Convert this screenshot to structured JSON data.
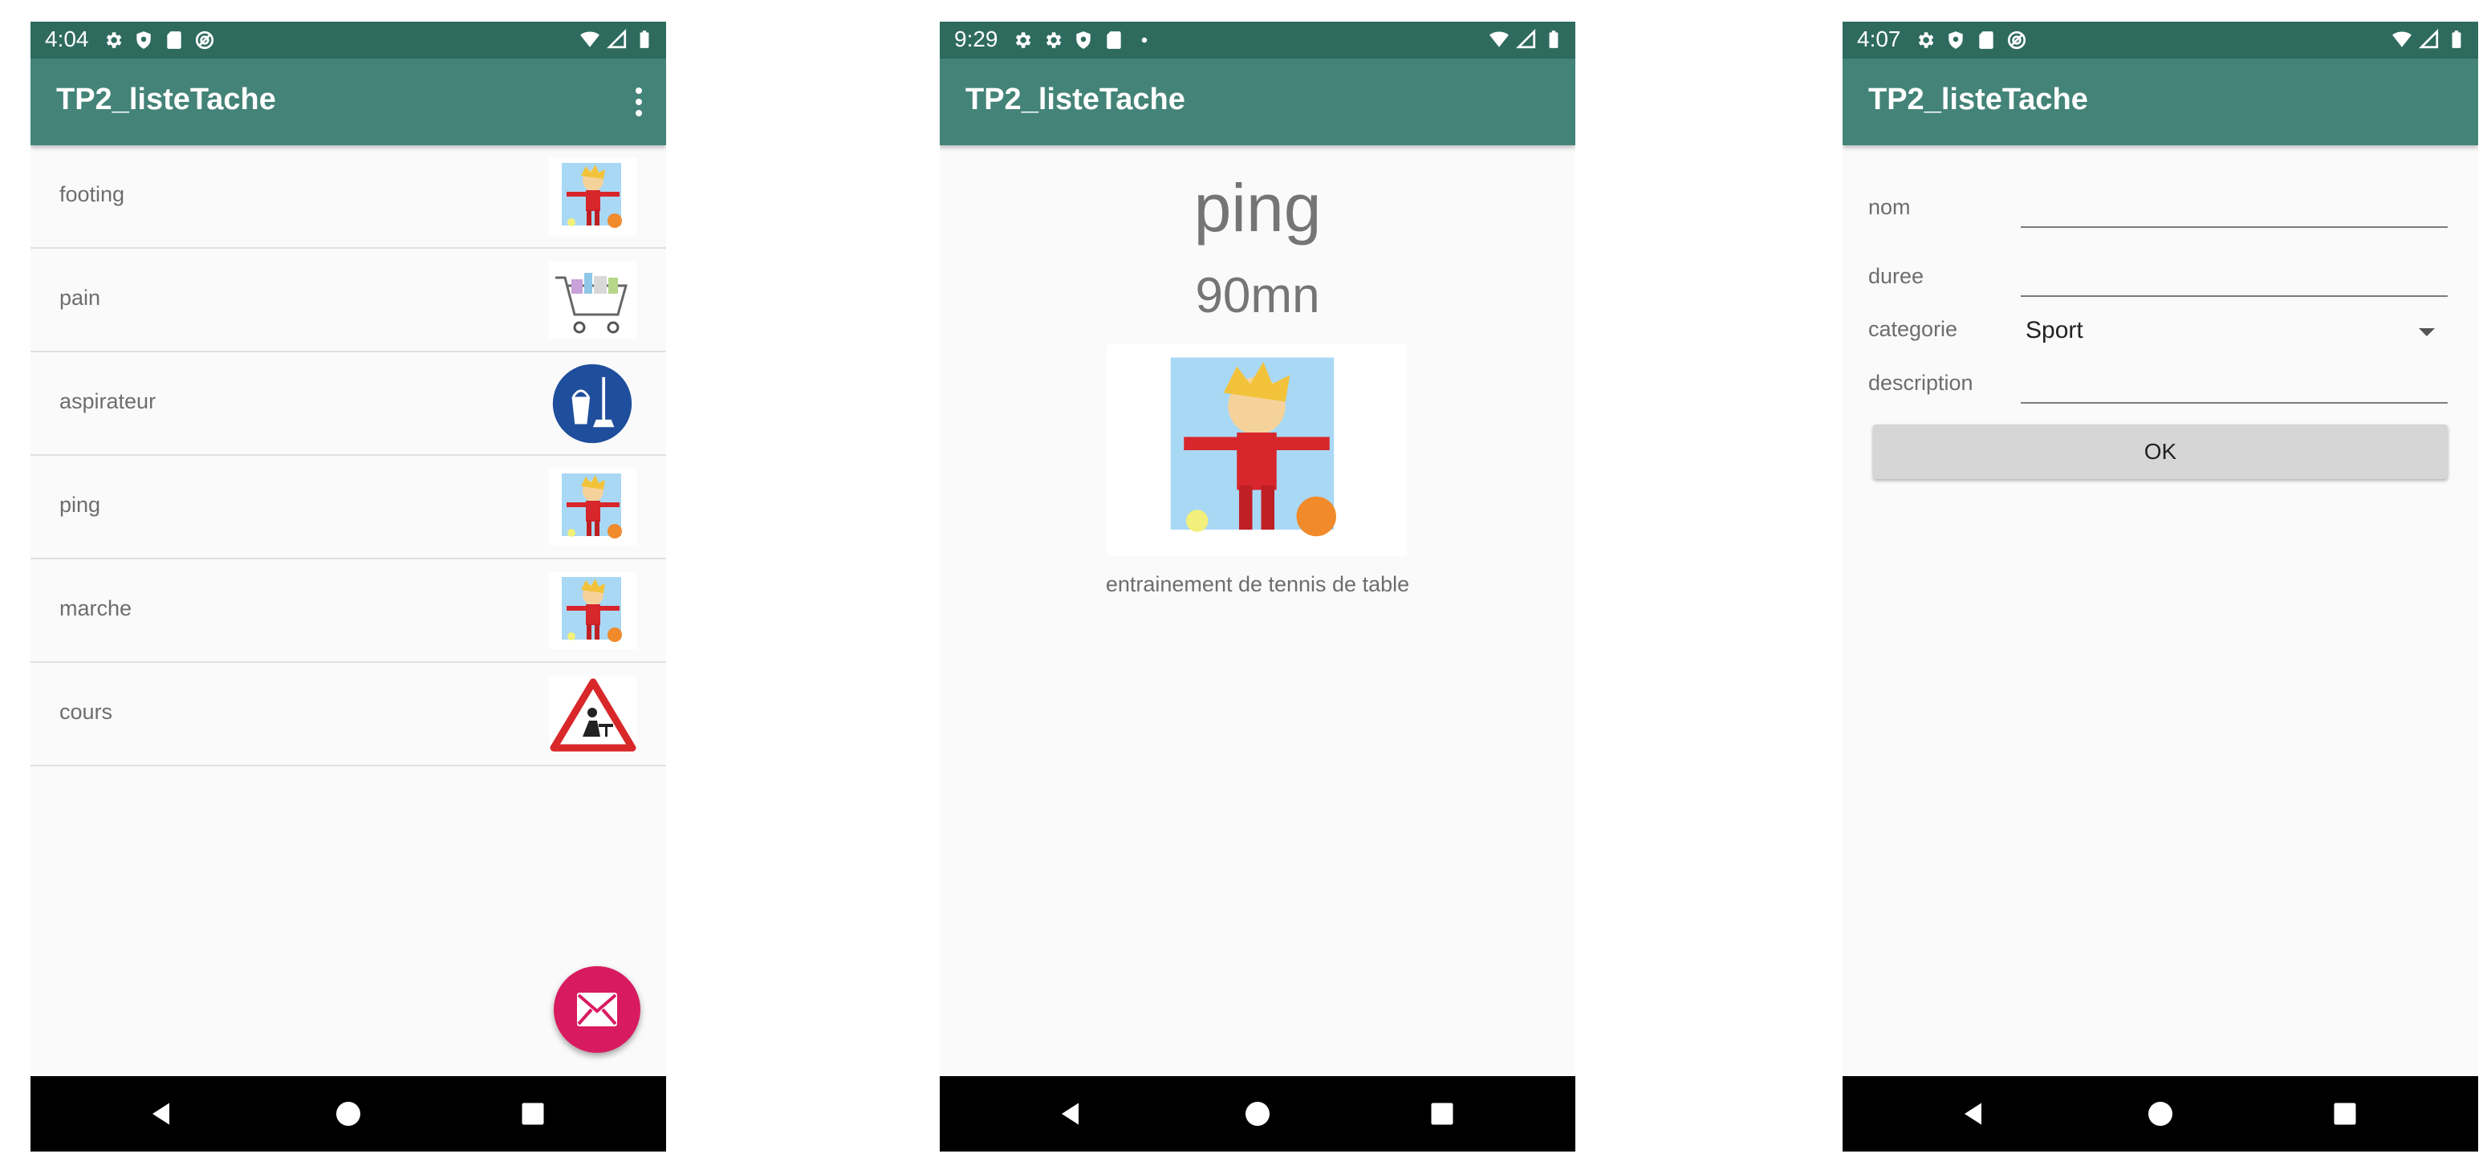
{
  "app": {
    "title": "TP2_listeTache",
    "accent": "#448378",
    "status_color": "#2e6b5e"
  },
  "screens": [
    {
      "status_time": "4:04",
      "tasks": [
        {
          "name": "footing",
          "icon": "sport-kid-icon"
        },
        {
          "name": "pain",
          "icon": "shopping-cart-icon"
        },
        {
          "name": "aspirateur",
          "icon": "cleaning-sign-icon"
        },
        {
          "name": "ping",
          "icon": "sport-kid-icon"
        },
        {
          "name": "marche",
          "icon": "sport-kid-icon"
        },
        {
          "name": "cours",
          "icon": "school-warning-icon"
        }
      ],
      "fab_icon": "mail-icon",
      "fab_color": "#d81b60"
    },
    {
      "status_time": "9:29",
      "detail": {
        "name": "ping",
        "duration": "90mn",
        "description": "entrainement de tennis de table",
        "icon": "sport-kid-icon"
      }
    },
    {
      "status_time": "4:07",
      "form": {
        "nom_label": "nom",
        "duree_label": "duree",
        "categorie_label": "categorie",
        "categorie_value": "Sport",
        "description_label": "description",
        "ok_label": "OK"
      }
    }
  ]
}
